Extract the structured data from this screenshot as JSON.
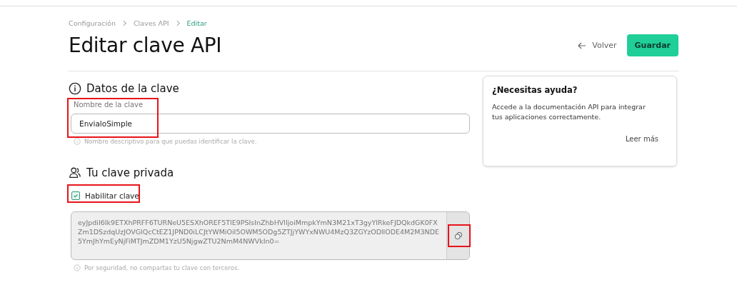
{
  "breadcrumb": [
    {
      "label": "Configuración",
      "current": false
    },
    {
      "label": "Claves API",
      "current": false
    },
    {
      "label": "Editar",
      "current": true
    }
  ],
  "title": "Editar clave API",
  "actions": {
    "back": "Volver",
    "save": "Guardar"
  },
  "key_data": {
    "heading": "Datos de la clave",
    "field_label": "Nombre de la clave",
    "value": "EnvialoSimple",
    "hint": "Nombre descriptivo para que puedas identificar la clave.",
    "highlighted": true
  },
  "private_key": {
    "heading": "Tu clave privada",
    "enable_label": "Habilitar clave",
    "enabled": true,
    "enable_highlighted": true,
    "key": "eyJpdiI6Ik9ETXhPRFF6TURNeU5ESXhOREF5TlE9PSIsInZhbHVlIjoiMmpkYmN3M21xT3gyYlRkeFJDQkdGK0FXZm1DSzdqUzJOVGlQcCtEZ1JPND0iLCJtYWMiOiI5OWM5ODg5ZTJjYWYxNWU4MzQ3ZGYzODllODE4M2M3NDE5YmJhYmEyNjFiMTJmZDM1YzU5NjgwZTU2NmM4NWVkIn0=",
    "copy_highlighted": true,
    "hint": "Por seguridad, no compartas tu clave con terceros."
  },
  "help": {
    "title": "¿Necesitas ayuda?",
    "text": "Accede a la documentación API para integrar tus aplicaciones correctamente.",
    "link": "Leer más"
  }
}
